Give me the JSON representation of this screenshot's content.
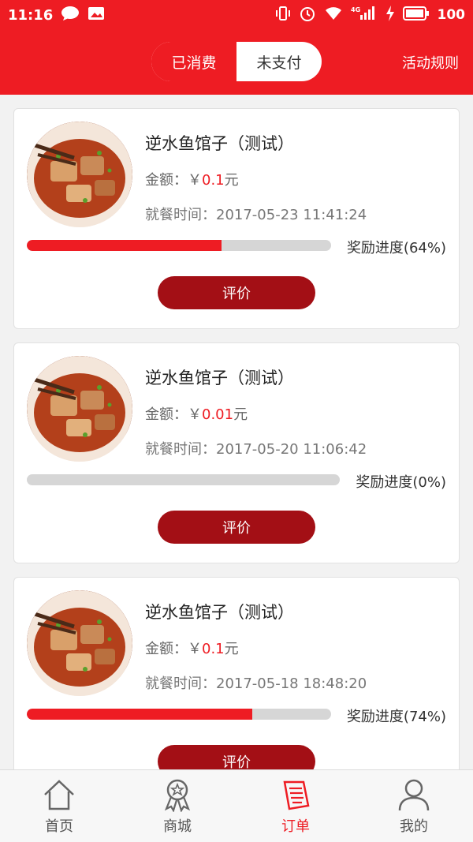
{
  "status_bar": {
    "time": "11:16",
    "battery": "100",
    "network": "4G"
  },
  "header": {
    "tabs": [
      {
        "label": "已消费",
        "active": true
      },
      {
        "label": "未支付",
        "active": false
      }
    ],
    "rules_label": "活动规则"
  },
  "labels": {
    "amount_prefix": "金额：",
    "currency": "￥",
    "unit": "元",
    "time_prefix": "就餐时间：",
    "review_button": "评价"
  },
  "orders": [
    {
      "store": "逆水鱼馆子（测试）",
      "amount": "0.1",
      "time": "2017-05-23 11:41:24",
      "progress": 64,
      "progress_label": "奖励进度(64%)"
    },
    {
      "store": "逆水鱼馆子（测试）",
      "amount": "0.01",
      "time": "2017-05-20 11:06:42",
      "progress": 0,
      "progress_label": "奖励进度(0%)"
    },
    {
      "store": "逆水鱼馆子（测试）",
      "amount": "0.1",
      "time": "2017-05-18 18:48:20",
      "progress": 74,
      "progress_label": "奖励进度(74%)"
    }
  ],
  "bottom_nav": [
    {
      "label": "首页",
      "icon": "home-icon",
      "active": false
    },
    {
      "label": "商城",
      "icon": "award-icon",
      "active": false
    },
    {
      "label": "订单",
      "icon": "order-icon",
      "active": true
    },
    {
      "label": "我的",
      "icon": "user-icon",
      "active": false
    }
  ],
  "colors": {
    "brand": "#ee1c23",
    "button": "#a30f15",
    "track": "#d6d6d6"
  }
}
